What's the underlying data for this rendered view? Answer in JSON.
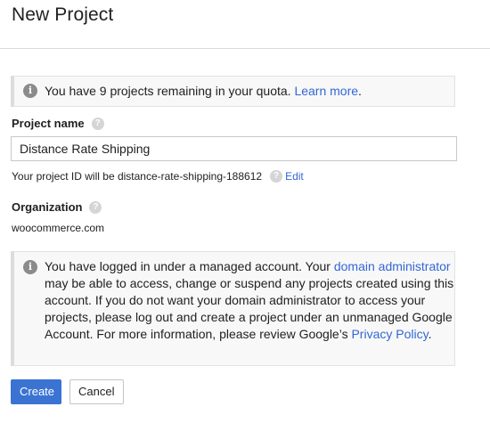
{
  "page": {
    "title": "New Project"
  },
  "quota_notice": {
    "text": "You have 9 projects remaining in your quota.",
    "link": "Learn more",
    "suffix": "."
  },
  "project_name": {
    "label": "Project name",
    "value": "Distance Rate Shipping",
    "help_icon": "help-icon"
  },
  "project_id": {
    "text": "Your project ID will be distance-rate-shipping-188612",
    "edit_label": "Edit"
  },
  "organization": {
    "label": "Organization",
    "value": "woocommerce.com",
    "help_icon": "help-icon"
  },
  "managed_notice": {
    "text_1": "You have logged in under a managed account. Your ",
    "link_1": "domain administrator",
    "text_2": " may be able to access, change or suspend any projects created using this account. If you do not want your domain administrator to access your projects, please log out and create a project under an unmanaged Google Account. For more information, please review Google’s ",
    "link_2": "Privacy Policy",
    "text_3": "."
  },
  "buttons": {
    "create": "Create",
    "cancel": "Cancel"
  },
  "colors": {
    "primary": "#3b73d3",
    "link": "#3367d6"
  }
}
